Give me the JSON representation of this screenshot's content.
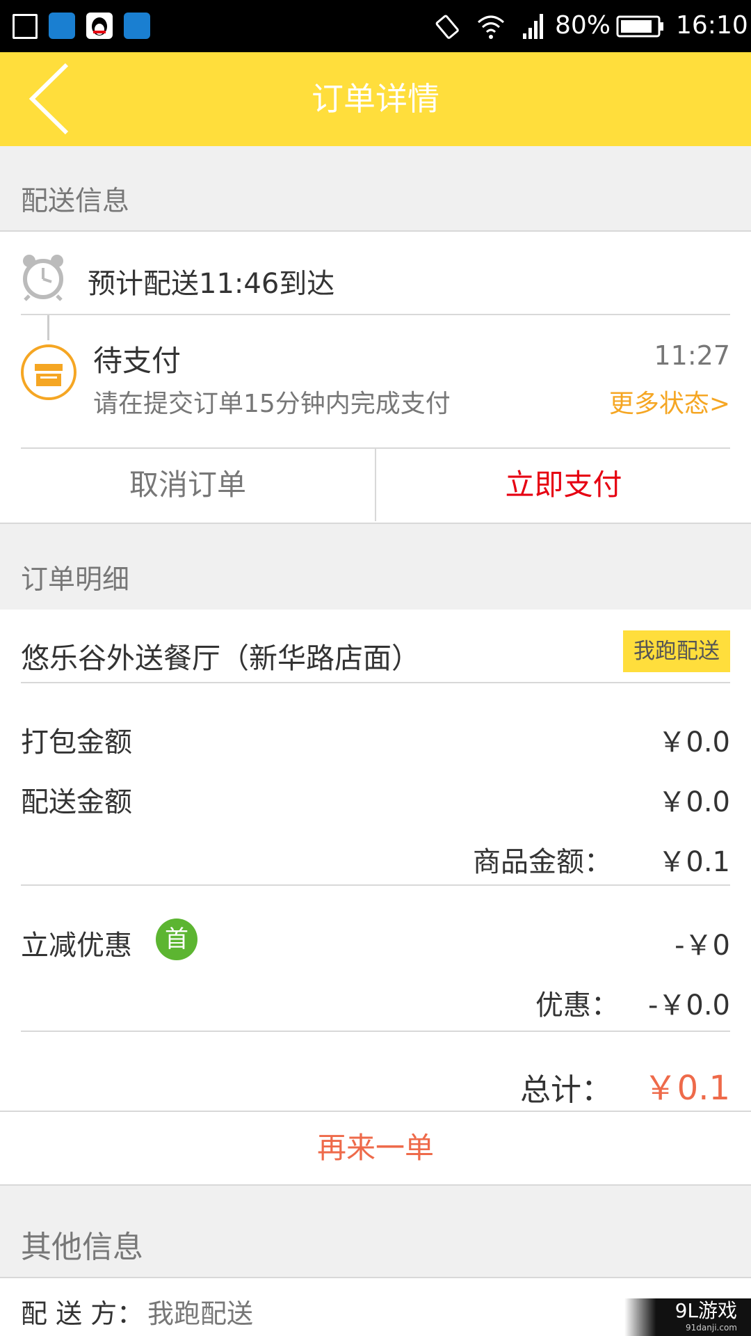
{
  "status_bar": {
    "battery": "80%",
    "time": "16:10"
  },
  "header": {
    "title": "订单详情"
  },
  "delivery_section": {
    "label": "配送信息",
    "eta": "预计配送11:46到达",
    "status_title": "待支付",
    "status_time": "11:27",
    "status_desc": "请在提交订单15分钟内完成支付",
    "more_status": "更多状态>",
    "cancel_label": "取消订单",
    "pay_label": "立即支付"
  },
  "order_section": {
    "label": "订单明细",
    "restaurant": "悠乐谷外送餐厅（新华路店面）",
    "delivery_badge": "我跑配送",
    "packing_label": "打包金额",
    "packing_value": "￥0.0",
    "delivery_fee_label": "配送金额",
    "delivery_fee_value": "￥0.0",
    "goods_label": "商品金额：",
    "goods_value": "￥0.1",
    "discount_label": "立减优惠",
    "discount_badge": "首",
    "discount_value": "-￥0",
    "total_discount_label": "优惠：",
    "total_discount_value": "-￥0.0",
    "total_label": "总计：",
    "total_value": "￥0.1",
    "reorder_label": "再来一单"
  },
  "other_section": {
    "label": "其他信息",
    "deliverer_label": "配 送 方：",
    "deliverer_value": "我跑配送"
  },
  "watermark": {
    "brand": "9L游戏",
    "url": "91danji.com"
  },
  "colors": {
    "header_bg": "#ffde3c",
    "accent_orange": "#f5a623",
    "pay_red": "#e60012",
    "total_coral": "#ee6a4a",
    "badge_yellow": "#ffde3c",
    "badge_green": "#5cb531"
  }
}
